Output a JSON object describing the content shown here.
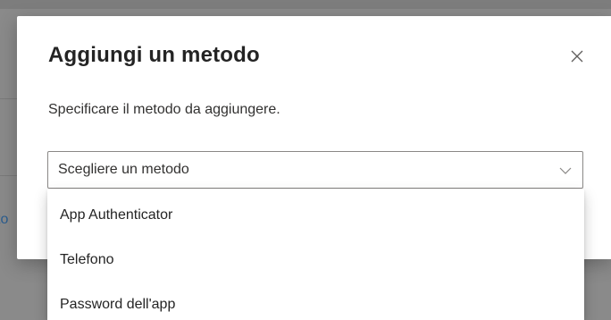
{
  "dialog": {
    "title": "Aggiungi un metodo",
    "description": "Specificare il metodo da aggiungere.",
    "close_icon": "close-icon"
  },
  "method_select": {
    "placeholder": "Scegliere un metodo",
    "chevron_icon": "chevron-down-icon",
    "options": [
      "App Authenticator",
      "Telefono",
      "Password dell'app"
    ]
  },
  "background": {
    "partial_text": "to"
  },
  "colors": {
    "overlay": "#8a8a8a",
    "dialog_bg": "#ffffff",
    "text_primary": "#242424",
    "border": "#8a8886"
  }
}
